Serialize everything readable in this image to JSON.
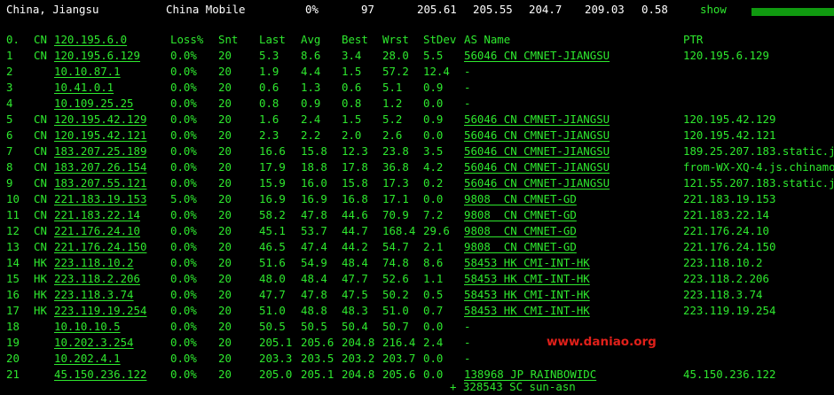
{
  "header": {
    "location": "China, Jiangsu",
    "isp": "China Mobile",
    "loss": "0%",
    "count": "97",
    "v1": "205.61",
    "v2": "205.55",
    "v3": "204.7",
    "v4": "209.03",
    "v5": "0.58",
    "show_label": "show",
    "bar_color": "#109a10"
  },
  "columns": {
    "idx": "0.",
    "cc": "CN",
    "host": "120.195.6.0",
    "loss": "Loss%",
    "snt": "Snt",
    "last": "Last",
    "avg": "Avg",
    "best": "Best",
    "wrst": "Wrst",
    "stdev": "StDev",
    "asname": "AS Name",
    "ptr": "PTR"
  },
  "rows": [
    {
      "idx": "1",
      "cc": "CN",
      "host": "120.195.6.129",
      "loss": "0.0%",
      "snt": "20",
      "last": "5.3",
      "avg": "8.6",
      "best": "3.4",
      "wrst": "28.0",
      "stdev": "5.5",
      "asname": "56046 CN CMNET-JIANGSU",
      "ptr": "120.195.6.129"
    },
    {
      "idx": "2",
      "cc": "",
      "host": "10.10.87.1",
      "loss": "0.0%",
      "snt": "20",
      "last": "1.9",
      "avg": "4.4",
      "best": "1.5",
      "wrst": "57.2",
      "stdev": "12.4",
      "asname": "-",
      "ptr": ""
    },
    {
      "idx": "3",
      "cc": "",
      "host": "10.41.0.1",
      "loss": "0.0%",
      "snt": "20",
      "last": "0.6",
      "avg": "1.3",
      "best": "0.6",
      "wrst": "5.1",
      "stdev": "0.9",
      "asname": "-",
      "ptr": ""
    },
    {
      "idx": "4",
      "cc": "",
      "host": "10.109.25.25",
      "loss": "0.0%",
      "snt": "20",
      "last": "0.8",
      "avg": "0.9",
      "best": "0.8",
      "wrst": "1.2",
      "stdev": "0.0",
      "asname": "-",
      "ptr": ""
    },
    {
      "idx": "5",
      "cc": "CN",
      "host": "120.195.42.129",
      "loss": "0.0%",
      "snt": "20",
      "last": "1.6",
      "avg": "2.4",
      "best": "1.5",
      "wrst": "5.2",
      "stdev": "0.9",
      "asname": "56046 CN CMNET-JIANGSU",
      "ptr": "120.195.42.129"
    },
    {
      "idx": "6",
      "cc": "CN",
      "host": "120.195.42.121",
      "loss": "0.0%",
      "snt": "20",
      "last": "2.3",
      "avg": "2.2",
      "best": "2.0",
      "wrst": "2.6",
      "stdev": "0.0",
      "asname": "56046 CN CMNET-JIANGSU",
      "ptr": "120.195.42.121"
    },
    {
      "idx": "7",
      "cc": "CN",
      "host": "183.207.25.189",
      "loss": "0.0%",
      "snt": "20",
      "last": "16.6",
      "avg": "15.8",
      "best": "12.3",
      "wrst": "23.8",
      "stdev": "3.5",
      "asname": "56046 CN CMNET-JIANGSU",
      "ptr": "189.25.207.183.static.j"
    },
    {
      "idx": "8",
      "cc": "CN",
      "host": "183.207.26.154",
      "loss": "0.0%",
      "snt": "20",
      "last": "17.9",
      "avg": "18.8",
      "best": "17.8",
      "wrst": "36.8",
      "stdev": "4.2",
      "asname": "56046 CN CMNET-JIANGSU",
      "ptr": "from-WX-XQ-4.js.chinamo"
    },
    {
      "idx": "9",
      "cc": "CN",
      "host": "183.207.55.121",
      "loss": "0.0%",
      "snt": "20",
      "last": "15.9",
      "avg": "16.0",
      "best": "15.8",
      "wrst": "17.3",
      "stdev": "0.2",
      "asname": "56046 CN CMNET-JIANGSU",
      "ptr": "121.55.207.183.static.j"
    },
    {
      "idx": "10",
      "cc": "CN",
      "host": "221.183.19.153",
      "loss": "5.0%",
      "snt": "20",
      "last": "16.9",
      "avg": "16.9",
      "best": "16.8",
      "wrst": "17.1",
      "stdev": "0.0",
      "asname": "9808  CN CMNET-GD",
      "ptr": "221.183.19.153"
    },
    {
      "idx": "11",
      "cc": "CN",
      "host": "221.183.22.14",
      "loss": "0.0%",
      "snt": "20",
      "last": "58.2",
      "avg": "47.8",
      "best": "44.6",
      "wrst": "70.9",
      "stdev": "7.2",
      "asname": "9808  CN CMNET-GD",
      "ptr": "221.183.22.14"
    },
    {
      "idx": "12",
      "cc": "CN",
      "host": "221.176.24.10",
      "loss": "0.0%",
      "snt": "20",
      "last": "45.1",
      "avg": "53.7",
      "best": "44.7",
      "wrst": "168.4",
      "stdev": "29.6",
      "asname": "9808  CN CMNET-GD",
      "ptr": "221.176.24.10"
    },
    {
      "idx": "13",
      "cc": "CN",
      "host": "221.176.24.150",
      "loss": "0.0%",
      "snt": "20",
      "last": "46.5",
      "avg": "47.4",
      "best": "44.2",
      "wrst": "54.7",
      "stdev": "2.1",
      "asname": "9808  CN CMNET-GD",
      "ptr": "221.176.24.150"
    },
    {
      "idx": "14",
      "cc": "HK",
      "host": "223.118.10.2",
      "loss": "0.0%",
      "snt": "20",
      "last": "51.6",
      "avg": "54.9",
      "best": "48.4",
      "wrst": "74.8",
      "stdev": "8.6",
      "asname": "58453 HK CMI-INT-HK",
      "ptr": "223.118.10.2"
    },
    {
      "idx": "15",
      "cc": "HK",
      "host": "223.118.2.206",
      "loss": "0.0%",
      "snt": "20",
      "last": "48.0",
      "avg": "48.4",
      "best": "47.7",
      "wrst": "52.6",
      "stdev": "1.1",
      "asname": "58453 HK CMI-INT-HK",
      "ptr": "223.118.2.206"
    },
    {
      "idx": "16",
      "cc": "HK",
      "host": "223.118.3.74",
      "loss": "0.0%",
      "snt": "20",
      "last": "47.7",
      "avg": "47.8",
      "best": "47.5",
      "wrst": "50.2",
      "stdev": "0.5",
      "asname": "58453 HK CMI-INT-HK",
      "ptr": "223.118.3.74"
    },
    {
      "idx": "17",
      "cc": "HK",
      "host": "223.119.19.254",
      "loss": "0.0%",
      "snt": "20",
      "last": "51.0",
      "avg": "48.8",
      "best": "48.3",
      "wrst": "51.0",
      "stdev": "0.7",
      "asname": "58453 HK CMI-INT-HK",
      "ptr": "223.119.19.254"
    },
    {
      "idx": "18",
      "cc": "",
      "host": "10.10.10.5",
      "loss": "0.0%",
      "snt": "20",
      "last": "50.5",
      "avg": "50.5",
      "best": "50.4",
      "wrst": "50.7",
      "stdev": "0.0",
      "asname": "-",
      "ptr": ""
    },
    {
      "idx": "19",
      "cc": "",
      "host": "10.202.3.254",
      "loss": "0.0%",
      "snt": "20",
      "last": "205.1",
      "avg": "205.6",
      "best": "204.8",
      "wrst": "216.4",
      "stdev": "2.4",
      "asname": "-",
      "ptr": ""
    },
    {
      "idx": "20",
      "cc": "",
      "host": "10.202.4.1",
      "loss": "0.0%",
      "snt": "20",
      "last": "203.3",
      "avg": "203.5",
      "best": "203.2",
      "wrst": "203.7",
      "stdev": "0.0",
      "asname": "-",
      "ptr": ""
    },
    {
      "idx": "21",
      "cc": "",
      "host": "45.150.236.122",
      "loss": "0.0%",
      "snt": "20",
      "last": "205.0",
      "avg": "205.1",
      "best": "204.8",
      "wrst": "205.6",
      "stdev": "0.0",
      "asname": "138968 JP RAINBOWIDC",
      "ptr": "45.150.236.122"
    }
  ],
  "extra_line": "+ 328543 SC sun-asn",
  "watermark": "www.daniao.org",
  "colors": {
    "text_green": "#2ee82e",
    "header_white": "#ffffff",
    "watermark_red": "#e0201a",
    "background": "#000000"
  }
}
